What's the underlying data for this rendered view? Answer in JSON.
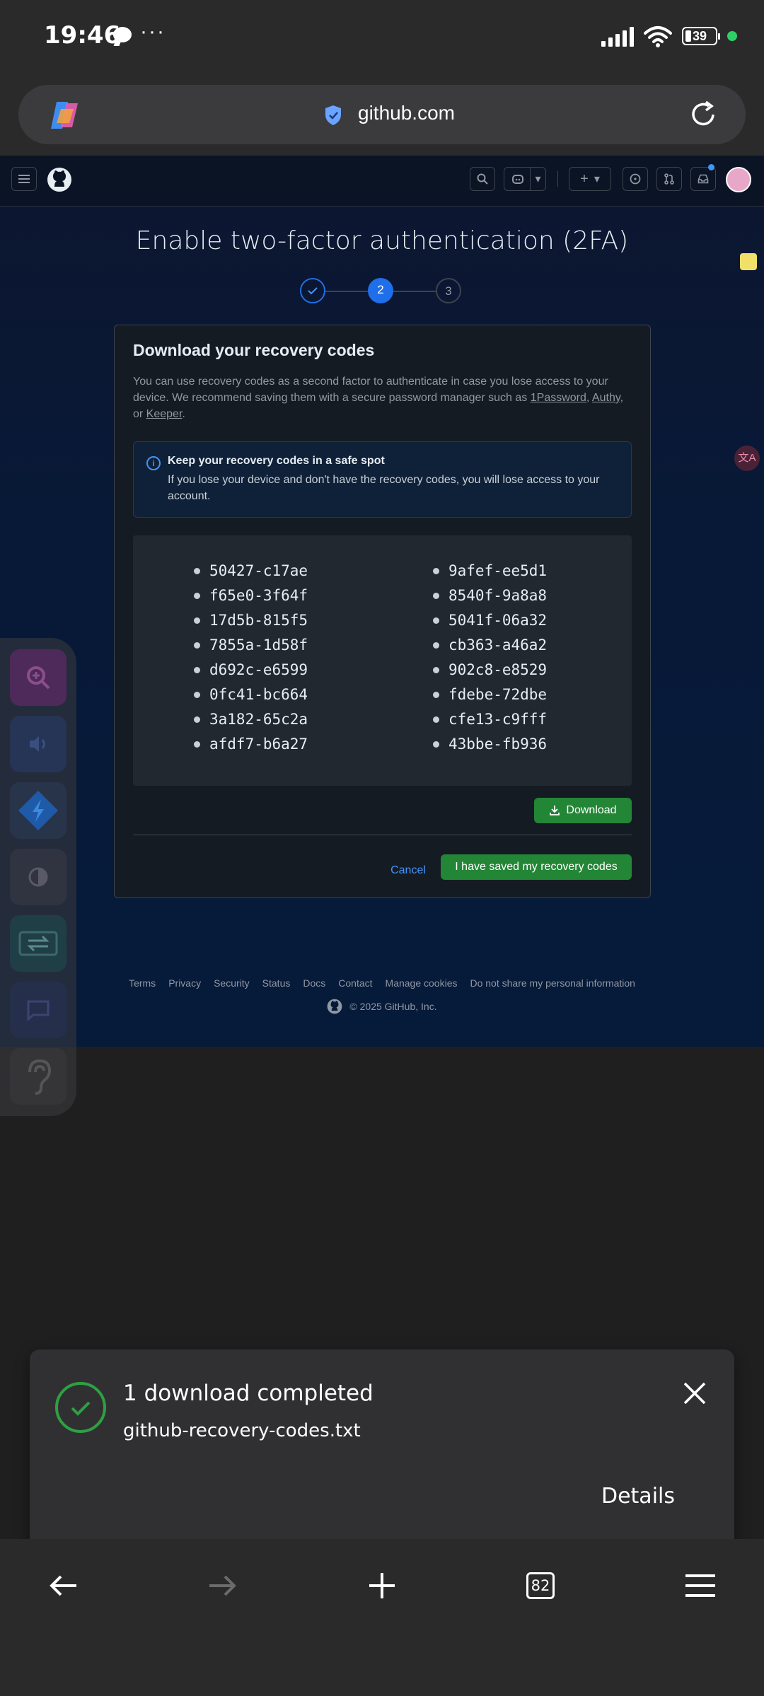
{
  "status_bar": {
    "time": "19:46",
    "dots": "···",
    "battery": "39"
  },
  "browser": {
    "url": "github.com",
    "tab_count": "82"
  },
  "github": {
    "page_title": "Enable two-factor authentication (2FA)",
    "steps": [
      "2",
      "3"
    ],
    "card": {
      "title": "Download your recovery codes",
      "description": "You can use recovery codes as a second factor to authenticate in case you lose access to your device. We recommend saving them with a secure password manager such as ",
      "link_1password": "1Password",
      "sep1": ", ",
      "link_authy": "Authy",
      "sep2": ", or ",
      "link_keeper": "Keeper",
      "end": ".",
      "flash_title": "Keep your recovery codes in a safe spot",
      "flash_text": "If you lose your device and don't have the recovery codes, you will lose access to your account.",
      "codes_left": [
        "50427-c17ae",
        "f65e0-3f64f",
        "17d5b-815f5",
        "7855a-1d58f",
        "d692c-e6599",
        "0fc41-bc664",
        "3a182-65c2a",
        "afdf7-b6a27"
      ],
      "codes_right": [
        "9afef-ee5d1",
        "8540f-9a8a8",
        "5041f-06a32",
        "cb363-a46a2",
        "902c8-e8529",
        "fdebe-72dbe",
        "cfe13-c9fff",
        "43bbe-fb936"
      ],
      "download_label": "Download",
      "cancel_label": "Cancel",
      "saved_label": "I have saved my recovery codes"
    },
    "footer_links": [
      "Terms",
      "Privacy",
      "Security",
      "Status",
      "Docs",
      "Contact",
      "Manage cookies",
      "Do not share my personal information"
    ],
    "copyright": "© 2025 GitHub, Inc."
  },
  "toast": {
    "title": "1 download completed",
    "filename": "github-recovery-codes.txt",
    "details_label": "Details"
  },
  "colors": {
    "accent_blue": "#4493f8",
    "github_green": "#238636",
    "page_bg": "#061a3a"
  }
}
